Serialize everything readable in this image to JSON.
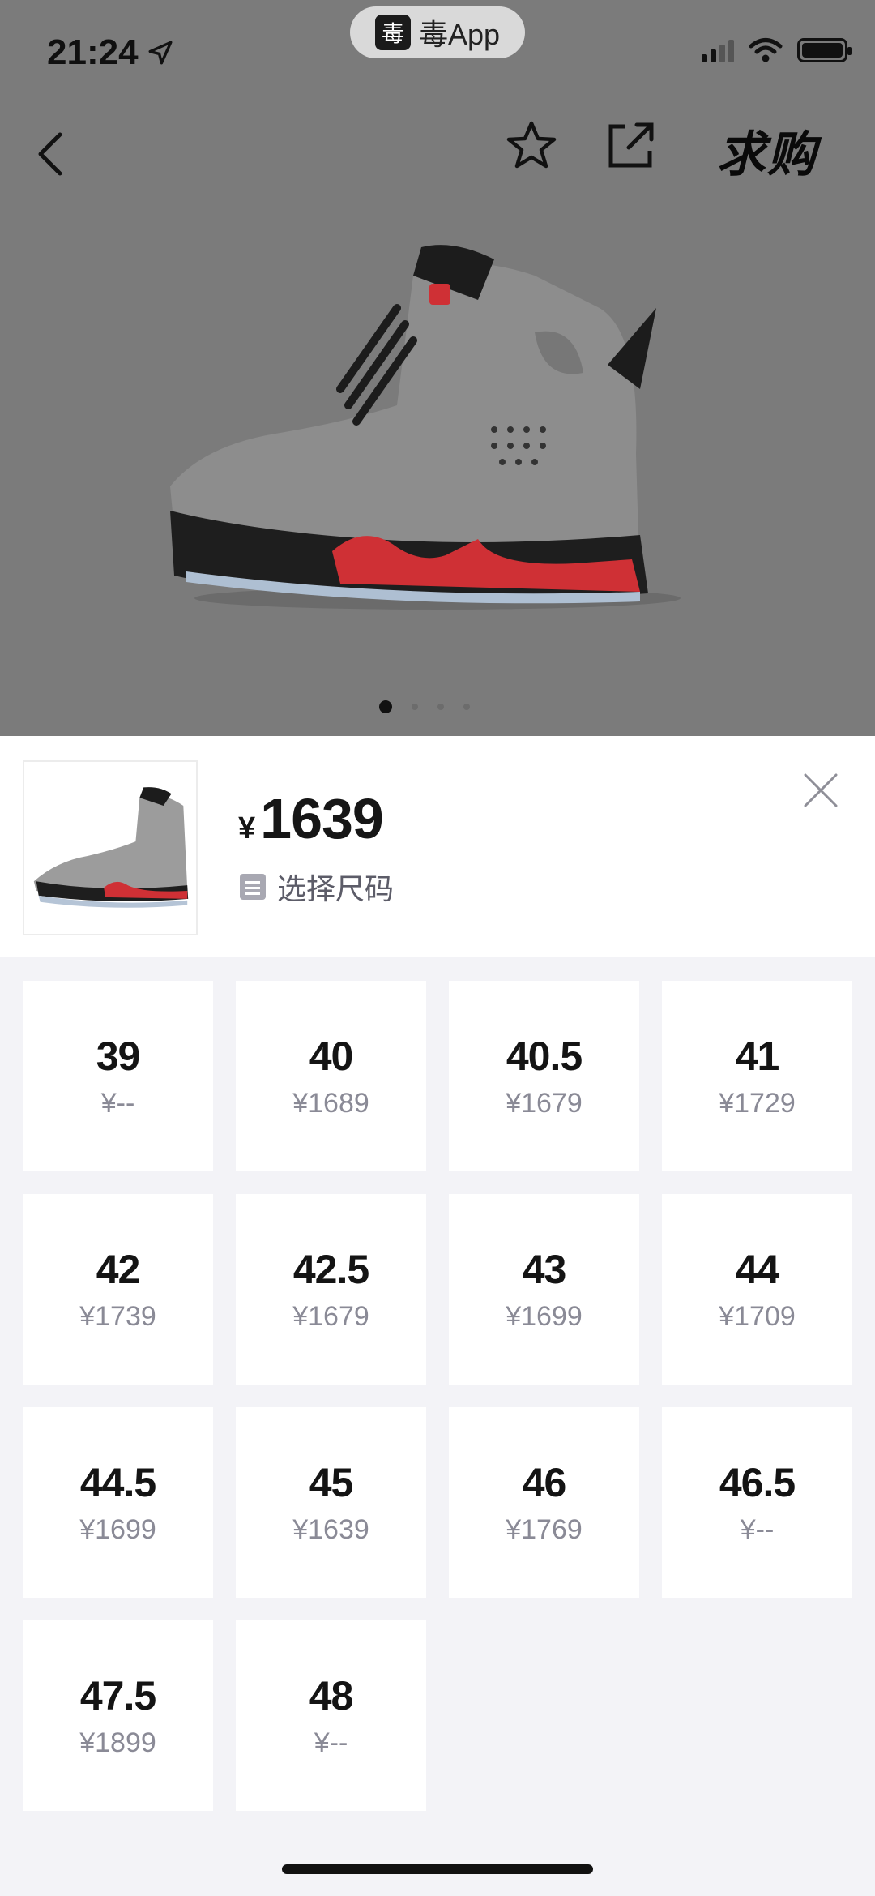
{
  "status_bar": {
    "time": "21:24",
    "app_label": "毒App",
    "app_mark": "毒"
  },
  "nav": {
    "title_action": "求购"
  },
  "carousel": {
    "pages": 4,
    "active": 0
  },
  "product": {
    "currency": "¥",
    "price": "1639",
    "select_size_label": "选择尺码"
  },
  "sizes": [
    {
      "size": "39",
      "price": "¥--"
    },
    {
      "size": "40",
      "price": "¥1689"
    },
    {
      "size": "40.5",
      "price": "¥1679"
    },
    {
      "size": "41",
      "price": "¥1729"
    },
    {
      "size": "42",
      "price": "¥1739"
    },
    {
      "size": "42.5",
      "price": "¥1679"
    },
    {
      "size": "43",
      "price": "¥1699"
    },
    {
      "size": "44",
      "price": "¥1709"
    },
    {
      "size": "44.5",
      "price": "¥1699"
    },
    {
      "size": "45",
      "price": "¥1639"
    },
    {
      "size": "46",
      "price": "¥1769"
    },
    {
      "size": "46.5",
      "price": "¥--"
    },
    {
      "size": "47.5",
      "price": "¥1899"
    },
    {
      "size": "48",
      "price": "¥--"
    }
  ],
  "icons": {
    "back": "chevron-left-icon",
    "favorite": "star-icon",
    "share": "share-icon",
    "close": "close-icon",
    "location": "location-arrow-icon",
    "wifi": "wifi-icon",
    "battery": "battery-icon",
    "signal": "signal-icon",
    "size_selector": "size-list-icon"
  },
  "colors": {
    "overlay": "#7b7b7b",
    "sheet_bg": "#f3f3f7",
    "accent_red": "#d6333b"
  }
}
